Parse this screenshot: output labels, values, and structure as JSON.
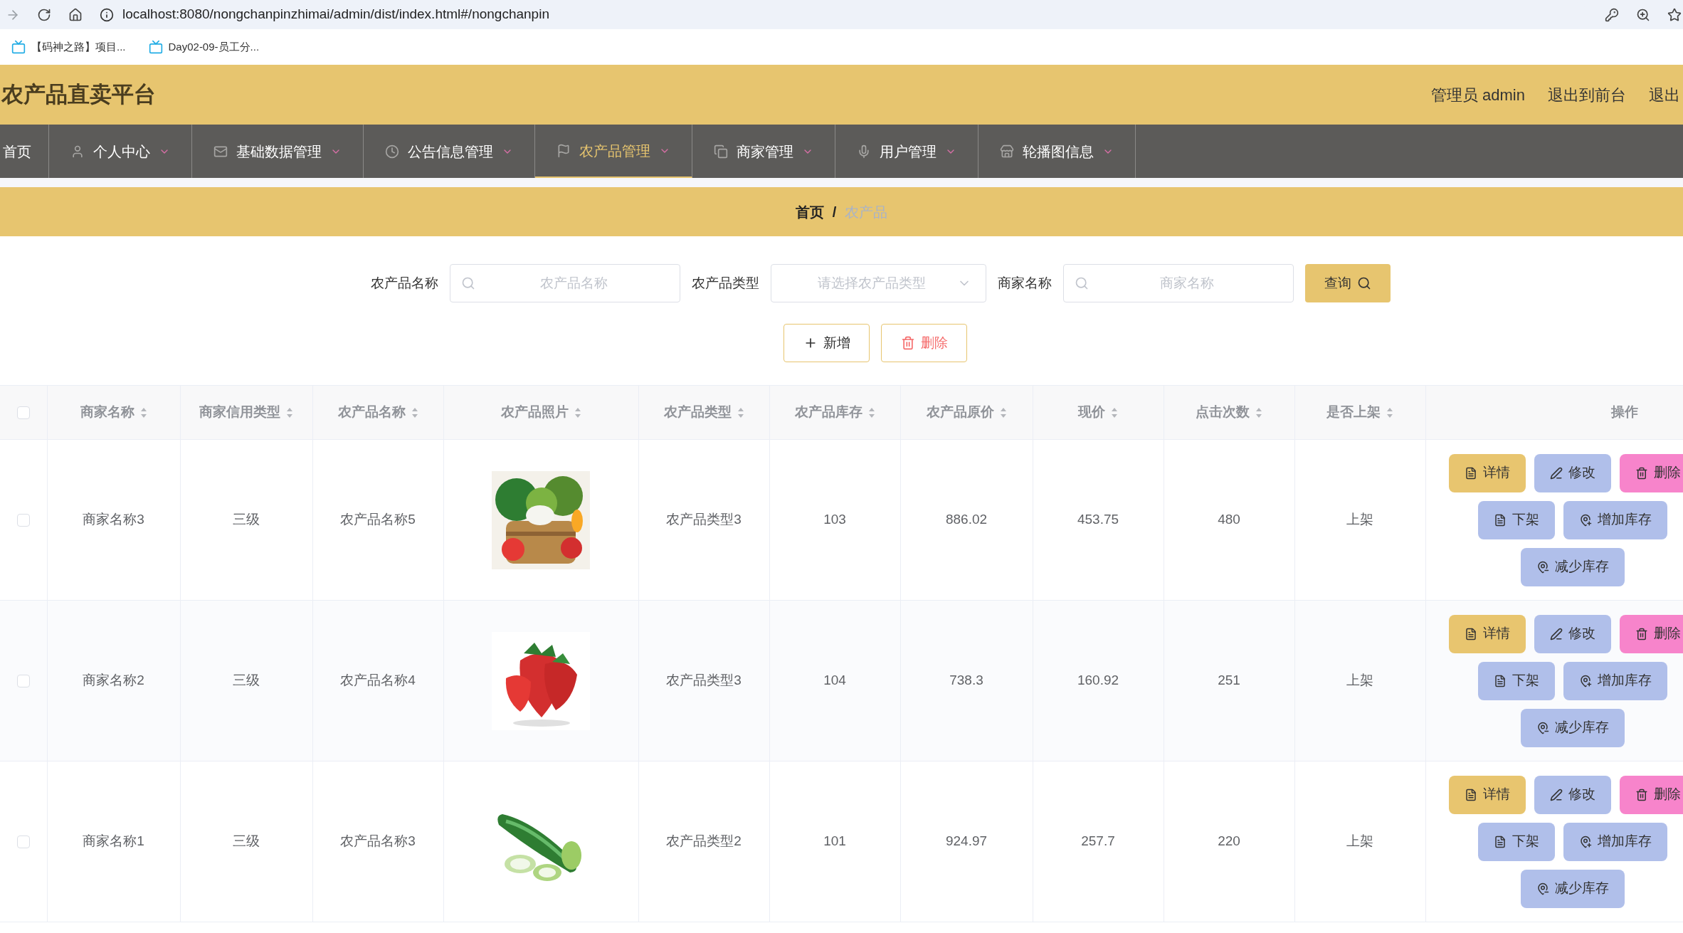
{
  "browser": {
    "url": "localhost:8080/nongchanpinzhimai/admin/dist/index.html#/nongchanpin",
    "bookmarks": [
      "【码神之路】项目...",
      "Day02-09-员工分..."
    ]
  },
  "header": {
    "title": "农产品直卖平台",
    "links": [
      "管理员 admin",
      "退出到前台",
      "退出"
    ]
  },
  "nav": [
    {
      "label": "首页",
      "selected": false
    },
    {
      "label": "个人中心",
      "selected": false
    },
    {
      "label": "基础数据管理",
      "selected": false
    },
    {
      "label": "公告信息管理",
      "selected": false
    },
    {
      "label": "农产品管理",
      "selected": true
    },
    {
      "label": "商家管理",
      "selected": false
    },
    {
      "label": "用户管理",
      "selected": false
    },
    {
      "label": "轮播图信息",
      "selected": false
    }
  ],
  "breadcrumb": {
    "home": "首页",
    "separator": "/",
    "current": "农产品"
  },
  "search": {
    "fields": [
      {
        "label": "农产品名称",
        "kind": "input",
        "placeholder": "农产品名称"
      },
      {
        "label": "农产品类型",
        "kind": "select",
        "placeholder": "请选择农产品类型"
      },
      {
        "label": "商家名称",
        "kind": "input",
        "placeholder": "商家名称"
      }
    ],
    "button": "查询"
  },
  "actions": [
    {
      "label": "新增",
      "kind": "add"
    },
    {
      "label": "删除",
      "kind": "delete"
    }
  ],
  "table": {
    "select_all_checked": false,
    "columns": [
      {
        "label": "商家名称",
        "sortable": true
      },
      {
        "label": "商家信用类型",
        "sortable": true
      },
      {
        "label": "农产品名称",
        "sortable": true
      },
      {
        "label": "农产品照片",
        "sortable": true
      },
      {
        "label": "农产品类型",
        "sortable": true
      },
      {
        "label": "农产品库存",
        "sortable": true
      },
      {
        "label": "农产品原价",
        "sortable": true
      },
      {
        "label": "现价",
        "sortable": true
      },
      {
        "label": "点击次数",
        "sortable": true
      },
      {
        "label": "是否上架",
        "sortable": true
      },
      {
        "label": "操作",
        "sortable": false
      }
    ],
    "rows": [
      {
        "checked": false,
        "merchant": "商家名称3",
        "credit": "三级",
        "name": "农产品名称5",
        "type": "农产品类型3",
        "stock": "103",
        "price": "886.02",
        "now_price": "453.75",
        "clicks": "480",
        "listed": "上架",
        "buttons": [
          {
            "label": "详情",
            "kind": "detail"
          },
          {
            "label": "修改",
            "kind": "edit"
          },
          {
            "label": "删除",
            "kind": "delete"
          },
          {
            "label": "下架",
            "kind": "unlist"
          },
          {
            "label": "增加库存",
            "kind": "add_stock"
          },
          {
            "label": "减少库存",
            "kind": "reduce_stock"
          }
        ]
      },
      {
        "checked": false,
        "merchant": "商家名称2",
        "credit": "三级",
        "name": "农产品名称4",
        "type": "农产品类型3",
        "stock": "104",
        "price": "738.3",
        "now_price": "160.92",
        "clicks": "251",
        "listed": "上架",
        "buttons": [
          {
            "label": "详情",
            "kind": "detail"
          },
          {
            "label": "修改",
            "kind": "edit"
          },
          {
            "label": "删除",
            "kind": "delete"
          },
          {
            "label": "下架",
            "kind": "unlist"
          },
          {
            "label": "增加库存",
            "kind": "add_stock"
          },
          {
            "label": "减少库存",
            "kind": "reduce_stock"
          }
        ]
      },
      {
        "checked": false,
        "merchant": "商家名称1",
        "credit": "三级",
        "name": "农产品名称3",
        "type": "农产品类型2",
        "stock": "101",
        "price": "924.97",
        "now_price": "257.7",
        "clicks": "220",
        "listed": "上架",
        "buttons": [
          {
            "label": "详情",
            "kind": "detail"
          },
          {
            "label": "修改",
            "kind": "edit"
          },
          {
            "label": "删除",
            "kind": "delete"
          },
          {
            "label": "下架",
            "kind": "unlist"
          },
          {
            "label": "增加库存",
            "kind": "add_stock"
          },
          {
            "label": "减少库存",
            "kind": "reduce_stock"
          }
        ]
      }
    ]
  }
}
